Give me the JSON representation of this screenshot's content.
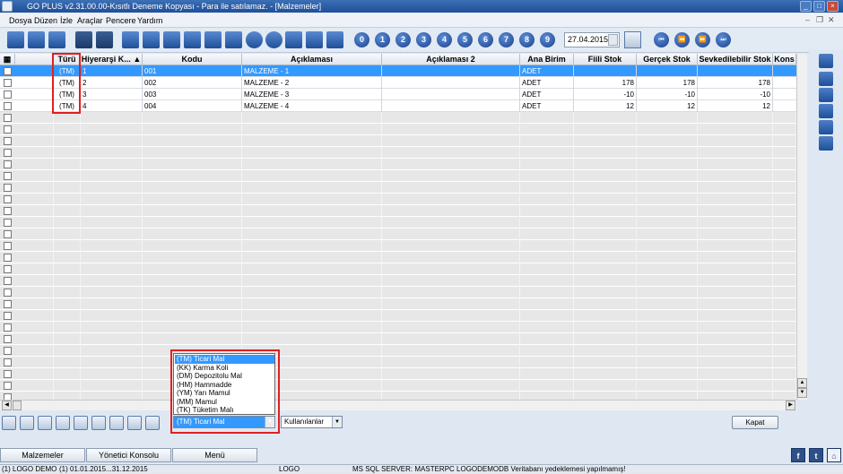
{
  "window": {
    "title": "GO PLUS v2.31.00.00-Kısıtlı Deneme Kopyası - Para ile satılamaz. - [Malzemeler]"
  },
  "menu": [
    "Dosya",
    "Düzen",
    "İzle",
    "Araçlar",
    "Pencere",
    "Yardım"
  ],
  "toolbar": {
    "number_buttons": [
      "0",
      "1",
      "2",
      "3",
      "4",
      "5",
      "6",
      "7",
      "8",
      "9"
    ],
    "date": "27.04.2015"
  },
  "grid": {
    "columns": [
      "Türü",
      "Hiyerarşi K...",
      "Kodu",
      "Açıklaması",
      "Açıklaması 2",
      "Ana Birim",
      "Fiili Stok",
      "Gerçek Stok",
      "Sevkedilebilir Stok",
      "Kons"
    ],
    "rows": [
      {
        "turu": "(TM)",
        "hiyerarsi": "1",
        "kodu": "001",
        "aciklama": "MALZEME - 1",
        "aciklama2": "",
        "birim": "ADET",
        "fiili": "",
        "gercek": "",
        "sevk": ""
      },
      {
        "turu": "(TM)",
        "hiyerarsi": "2",
        "kodu": "002",
        "aciklama": "MALZEME - 2",
        "aciklama2": "",
        "birim": "ADET",
        "fiili": "178",
        "gercek": "178",
        "sevk": "178"
      },
      {
        "turu": "(TM)",
        "hiyerarsi": "3",
        "kodu": "003",
        "aciklama": "MALZEME - 3",
        "aciklama2": "",
        "birim": "ADET",
        "fiili": "-10",
        "gercek": "-10",
        "sevk": "-10"
      },
      {
        "turu": "(TM)",
        "hiyerarsi": "4",
        "kodu": "004",
        "aciklama": "MALZEME - 4",
        "aciklama2": "",
        "birim": "ADET",
        "fiili": "12",
        "gercek": "12",
        "sevk": "12"
      }
    ]
  },
  "filter": {
    "type_selected": "(TM) Ticari Mal",
    "type_options": [
      "(TM) Ticari Mal",
      "(KK) Karma Koli",
      "(DM) Depozitolu Mal",
      "(HM) Hammadde",
      "(YM) Yarı Mamul",
      "(MM) Mamul",
      "(TK) Tüketim Malı"
    ],
    "users_selected": "Kullanılanlar"
  },
  "buttons": {
    "close": "Kapat"
  },
  "tabs": [
    "Malzemeler",
    "Yönetici Konsolu",
    "Menü"
  ],
  "social": [
    "f",
    "t"
  ],
  "status": [
    "(1) LOGO DEMO",
    "(1) 01.01.2015...31.12.2015",
    "LOGO",
    "MS SQL SERVER: MASTERPC LOGODEMODB Veritabanı yedeklemesi yapılmamış!"
  ],
  "colors": {
    "selection": "#3399ff",
    "accent": "#1e4f9a",
    "highlight": "#e02020"
  }
}
